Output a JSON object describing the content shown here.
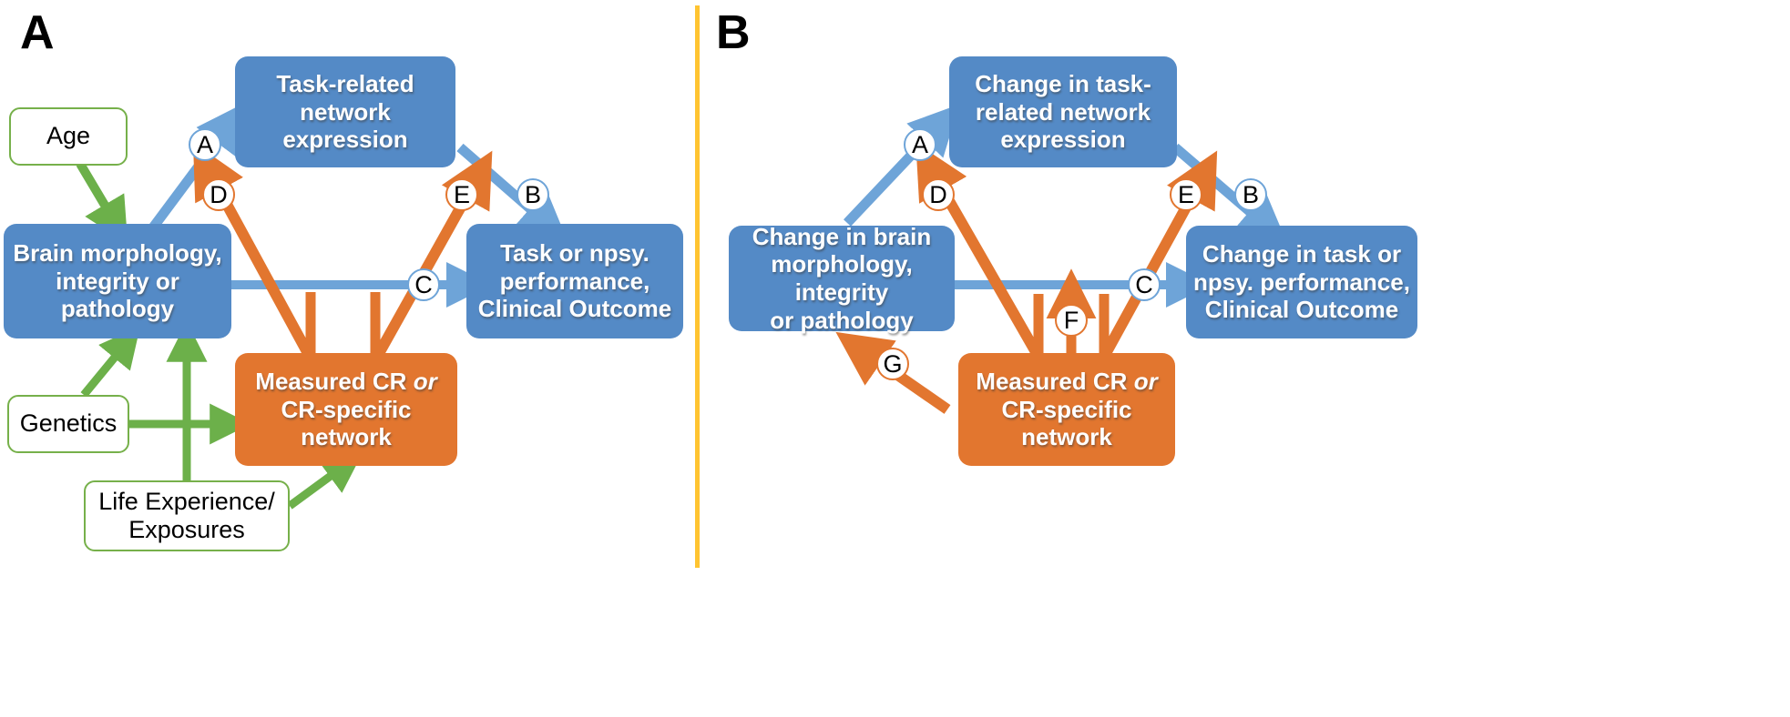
{
  "colors": {
    "blue_node": "#548ac6",
    "orange_node": "#e2762f",
    "green_edge": "#6cb04a",
    "blue_edge": "#6ea4d8",
    "orange_edge": "#e2762f",
    "divider": "#ffc431",
    "white_node_border": "#76b04a",
    "text_on_color": "#ffffff",
    "text_plain": "#000000"
  },
  "panels": [
    {
      "id": "panel-a",
      "letter": "A",
      "nodes": [
        {
          "id": "age",
          "kind": "white",
          "label": "Age"
        },
        {
          "id": "genetics",
          "kind": "white",
          "label": "Genetics"
        },
        {
          "id": "life",
          "kind": "white",
          "label": "Life Experience/\nExposures"
        },
        {
          "id": "brain",
          "kind": "blue",
          "label": "Brain morphology,\nintegrity or\npathology"
        },
        {
          "id": "task-net",
          "kind": "blue",
          "label": "Task-related\nnetwork\nexpression"
        },
        {
          "id": "outcome",
          "kind": "blue",
          "label": "Task or npsy.\nperformance,\nClinical Outcome"
        },
        {
          "id": "cr",
          "kind": "orange",
          "label": "Measured CR or\nCR-specific\nnetwork",
          "italic_word": "or"
        }
      ],
      "edge_labels": [
        {
          "id": "a",
          "text": "A",
          "ring": "blue"
        },
        {
          "id": "b",
          "text": "B",
          "ring": "blue"
        },
        {
          "id": "c",
          "text": "C",
          "ring": "blue"
        },
        {
          "id": "d",
          "text": "D",
          "ring": "orange"
        },
        {
          "id": "e",
          "text": "E",
          "ring": "orange"
        }
      ]
    },
    {
      "id": "panel-b",
      "letter": "B",
      "nodes": [
        {
          "id": "brain-b",
          "kind": "blue",
          "label": "Change in brain\nmorphology, integrity\nor pathology"
        },
        {
          "id": "task-net-b",
          "kind": "blue",
          "label": "Change in task-\nrelated network\nexpression"
        },
        {
          "id": "outcome-b",
          "kind": "blue",
          "label": "Change in task or\nnpsy.  performance,\nClinical Outcome"
        },
        {
          "id": "cr-b",
          "kind": "orange",
          "label": "Measured CR or\nCR-specific\nnetwork",
          "italic_word": "or"
        }
      ],
      "edge_labels": [
        {
          "id": "a",
          "text": "A",
          "ring": "blue"
        },
        {
          "id": "b",
          "text": "B",
          "ring": "blue"
        },
        {
          "id": "c",
          "text": "C",
          "ring": "blue"
        },
        {
          "id": "d",
          "text": "D",
          "ring": "orange"
        },
        {
          "id": "e",
          "text": "E",
          "ring": "orange"
        },
        {
          "id": "f",
          "text": "F",
          "ring": "orange"
        },
        {
          "id": "g",
          "text": "G",
          "ring": "orange"
        }
      ]
    }
  ]
}
